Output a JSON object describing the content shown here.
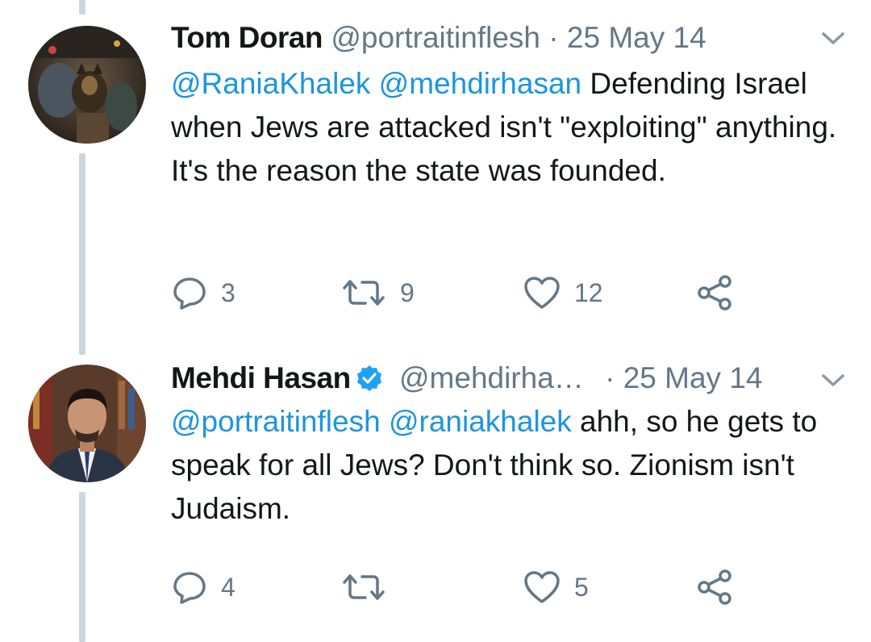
{
  "colors": {
    "link": "#1b95e0",
    "muted": "#657786",
    "text": "#14171a",
    "verified": "#1da1f2",
    "thread_line": "#cdd6dd"
  },
  "tweets": [
    {
      "name": "Tom Doran",
      "handle": "@portraitinflesh",
      "separator": "·",
      "date": "25 May 14",
      "verified": false,
      "mentions": [
        "@RaniaKhalek",
        "@mehdirhasan"
      ],
      "text": " Defending Israel when Jews are attacked isn't \"exploiting\" anything. It's the reason the state was founded.",
      "replies": "3",
      "retweets": "9",
      "likes": "12",
      "avatar_icon": "photo-avatar-dog-icon"
    },
    {
      "name": "Mehdi Hasan",
      "handle": "@mehdirha…",
      "separator": "·",
      "date": "25 May 14",
      "verified": true,
      "mentions": [
        "@portraitinflesh",
        "@raniakhalek"
      ],
      "text": " ahh, so he gets to speak for all Jews? Don't think so. Zionism isn't Judaism.",
      "replies": "4",
      "retweets": "",
      "likes": "5",
      "avatar_icon": "photo-avatar-man-icon"
    }
  ]
}
